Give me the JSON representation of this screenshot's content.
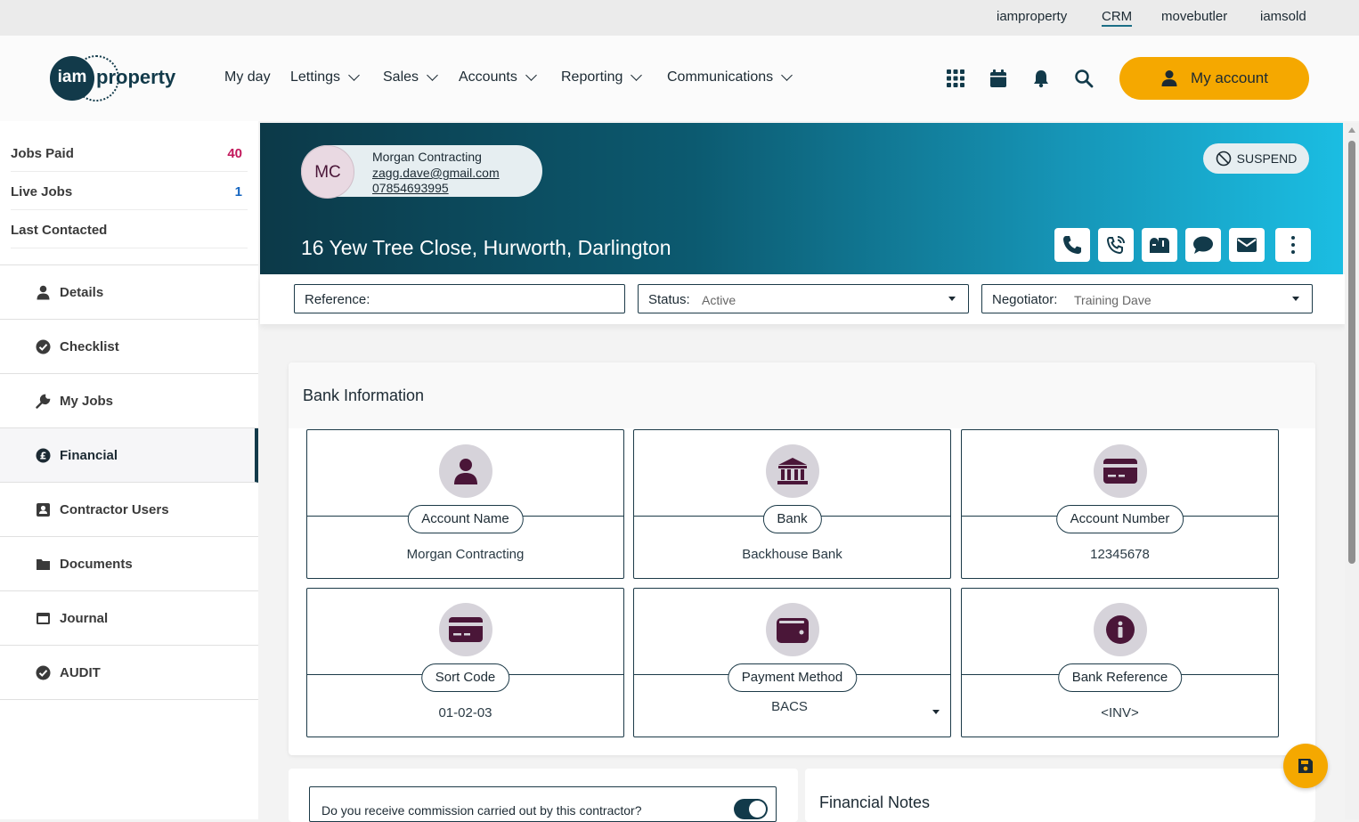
{
  "top_links": [
    "iamproperty",
    "CRM",
    "movebutler",
    "iamsold"
  ],
  "top_active": "CRM",
  "logo": {
    "circle_text": "iam",
    "word": "property"
  },
  "nav": [
    "My day",
    "Lettings",
    "Sales",
    "Accounts",
    "Reporting",
    "Communications"
  ],
  "header_icons": [
    "apps-grid-icon",
    "calendar-icon",
    "bell-icon",
    "search-icon"
  ],
  "my_account_label": "My account",
  "sidebar": {
    "stats": [
      {
        "label": "Jobs Paid",
        "value": "40",
        "color": "#c2185b"
      },
      {
        "label": "Live Jobs",
        "value": "1",
        "color": "#1565c0"
      },
      {
        "label": "Last Contacted",
        "value": ""
      }
    ],
    "menu": [
      {
        "label": "Details",
        "icon": "user-icon"
      },
      {
        "label": "Checklist",
        "icon": "check-circle-icon"
      },
      {
        "label": "My Jobs",
        "icon": "wrench-icon"
      },
      {
        "label": "Financial",
        "icon": "pound-circle-icon",
        "active": true
      },
      {
        "label": "Contractor Users",
        "icon": "contact-card-icon"
      },
      {
        "label": "Documents",
        "icon": "folder-icon"
      },
      {
        "label": "Journal",
        "icon": "journal-icon"
      },
      {
        "label": "AUDIT",
        "icon": "check-circle-icon"
      }
    ]
  },
  "contact": {
    "initials": "MC",
    "name": "Morgan Contracting",
    "email": "zagg.dave@gmail.com",
    "phone": "07854693995"
  },
  "suspend_label": "SUSPEND",
  "address": "16 Yew Tree Close, Hurworth, Darlington",
  "action_icons": [
    "phone-icon",
    "phone-call-icon",
    "mailbox-icon",
    "chat-icon",
    "email-icon",
    "more-vertical-icon"
  ],
  "fields": {
    "reference": {
      "label": "Reference:",
      "value": ""
    },
    "status": {
      "label": "Status:",
      "value": "Active"
    },
    "negotiator": {
      "label": "Negotiator:",
      "value": "Training Dave"
    }
  },
  "bank": {
    "title": "Bank Information",
    "tiles": [
      {
        "label": "Account Name",
        "value": "Morgan Contracting",
        "icon": "user-icon"
      },
      {
        "label": "Bank",
        "value": "Backhouse Bank",
        "icon": "bank-icon"
      },
      {
        "label": "Account Number",
        "value": "12345678",
        "icon": "credit-card-icon"
      },
      {
        "label": "Sort Code",
        "value": "01-02-03",
        "icon": "credit-card-icon"
      },
      {
        "label": "Payment Method",
        "value": "BACS",
        "icon": "wallet-icon"
      },
      {
        "label": "Bank Reference",
        "value": "<INV>",
        "icon": "info-icon"
      }
    ]
  },
  "commission_question": "Do you receive commission carried out by this contractor?",
  "commission_enabled": true,
  "financial_notes_title": "Financial Notes",
  "colors": {
    "accent": "#f5a800",
    "dark": "#123a4a",
    "icon_purple": "#4a1638"
  }
}
